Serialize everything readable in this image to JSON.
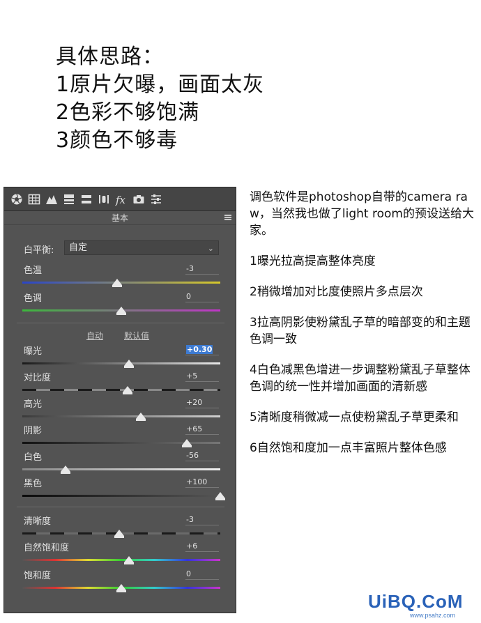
{
  "heading": {
    "lines": [
      "具体思路：",
      "1原片欠曝，画面太灰",
      "2色彩不够饱满",
      "3颜色不够毒"
    ]
  },
  "panel": {
    "toolbar_icons": [
      "aperture-icon",
      "grid-icon",
      "mountain-icon",
      "split-rows-icon",
      "split-tone-icon",
      "lens-icon",
      "fx-icon",
      "camera-icon",
      "sliders-icon"
    ],
    "title": "基本",
    "white_balance": {
      "label": "白平衡:",
      "value": "自定"
    },
    "temp": {
      "label": "色温",
      "value": "-3",
      "level": 0.48
    },
    "tint": {
      "label": "色调",
      "value": "0",
      "level": 0.5
    },
    "auto_label": "自动",
    "default_label": "默认值",
    "exposure": {
      "label": "曝光",
      "value": "+0.30",
      "level": 0.54
    },
    "contrast": {
      "label": "对比度",
      "value": "+5",
      "level": 0.53
    },
    "highlights": {
      "label": "高光",
      "value": "+20",
      "level": 0.6
    },
    "shadows": {
      "label": "阴影",
      "value": "+65",
      "level": 0.83
    },
    "whites": {
      "label": "白色",
      "value": "-56",
      "level": 0.22
    },
    "blacks": {
      "label": "黑色",
      "value": "+100",
      "level": 1.0
    },
    "clarity": {
      "label": "清晰度",
      "value": "-3",
      "level": 0.49
    },
    "vibrance": {
      "label": "自然饱和度",
      "value": "+6",
      "level": 0.54
    },
    "saturation": {
      "label": "饱和度",
      "value": "0",
      "level": 0.5
    }
  },
  "notes": [
    "调色软件是photoshop自带的camera raw，当然我也做了light room的预设送给大家。",
    "1曝光拉高提高整体亮度",
    "2稍微增加对比度使照片多点层次",
    "3拉高阴影使粉黛乱子草的暗部变的和主题色调一致",
    "4白色减黑色增进一步调整粉黛乱子草整体色调的统一性并增加画面的清新感",
    "5清晰度稍微减一点使粉黛乱子草更柔和",
    "6自然饱和度加一点丰富照片整体色感"
  ],
  "watermark": {
    "main": "UiBQ.CoM",
    "sub": "www.psahz.com"
  },
  "colors": {
    "panel_bg": "#535353",
    "accent": "#3d7ad1"
  }
}
